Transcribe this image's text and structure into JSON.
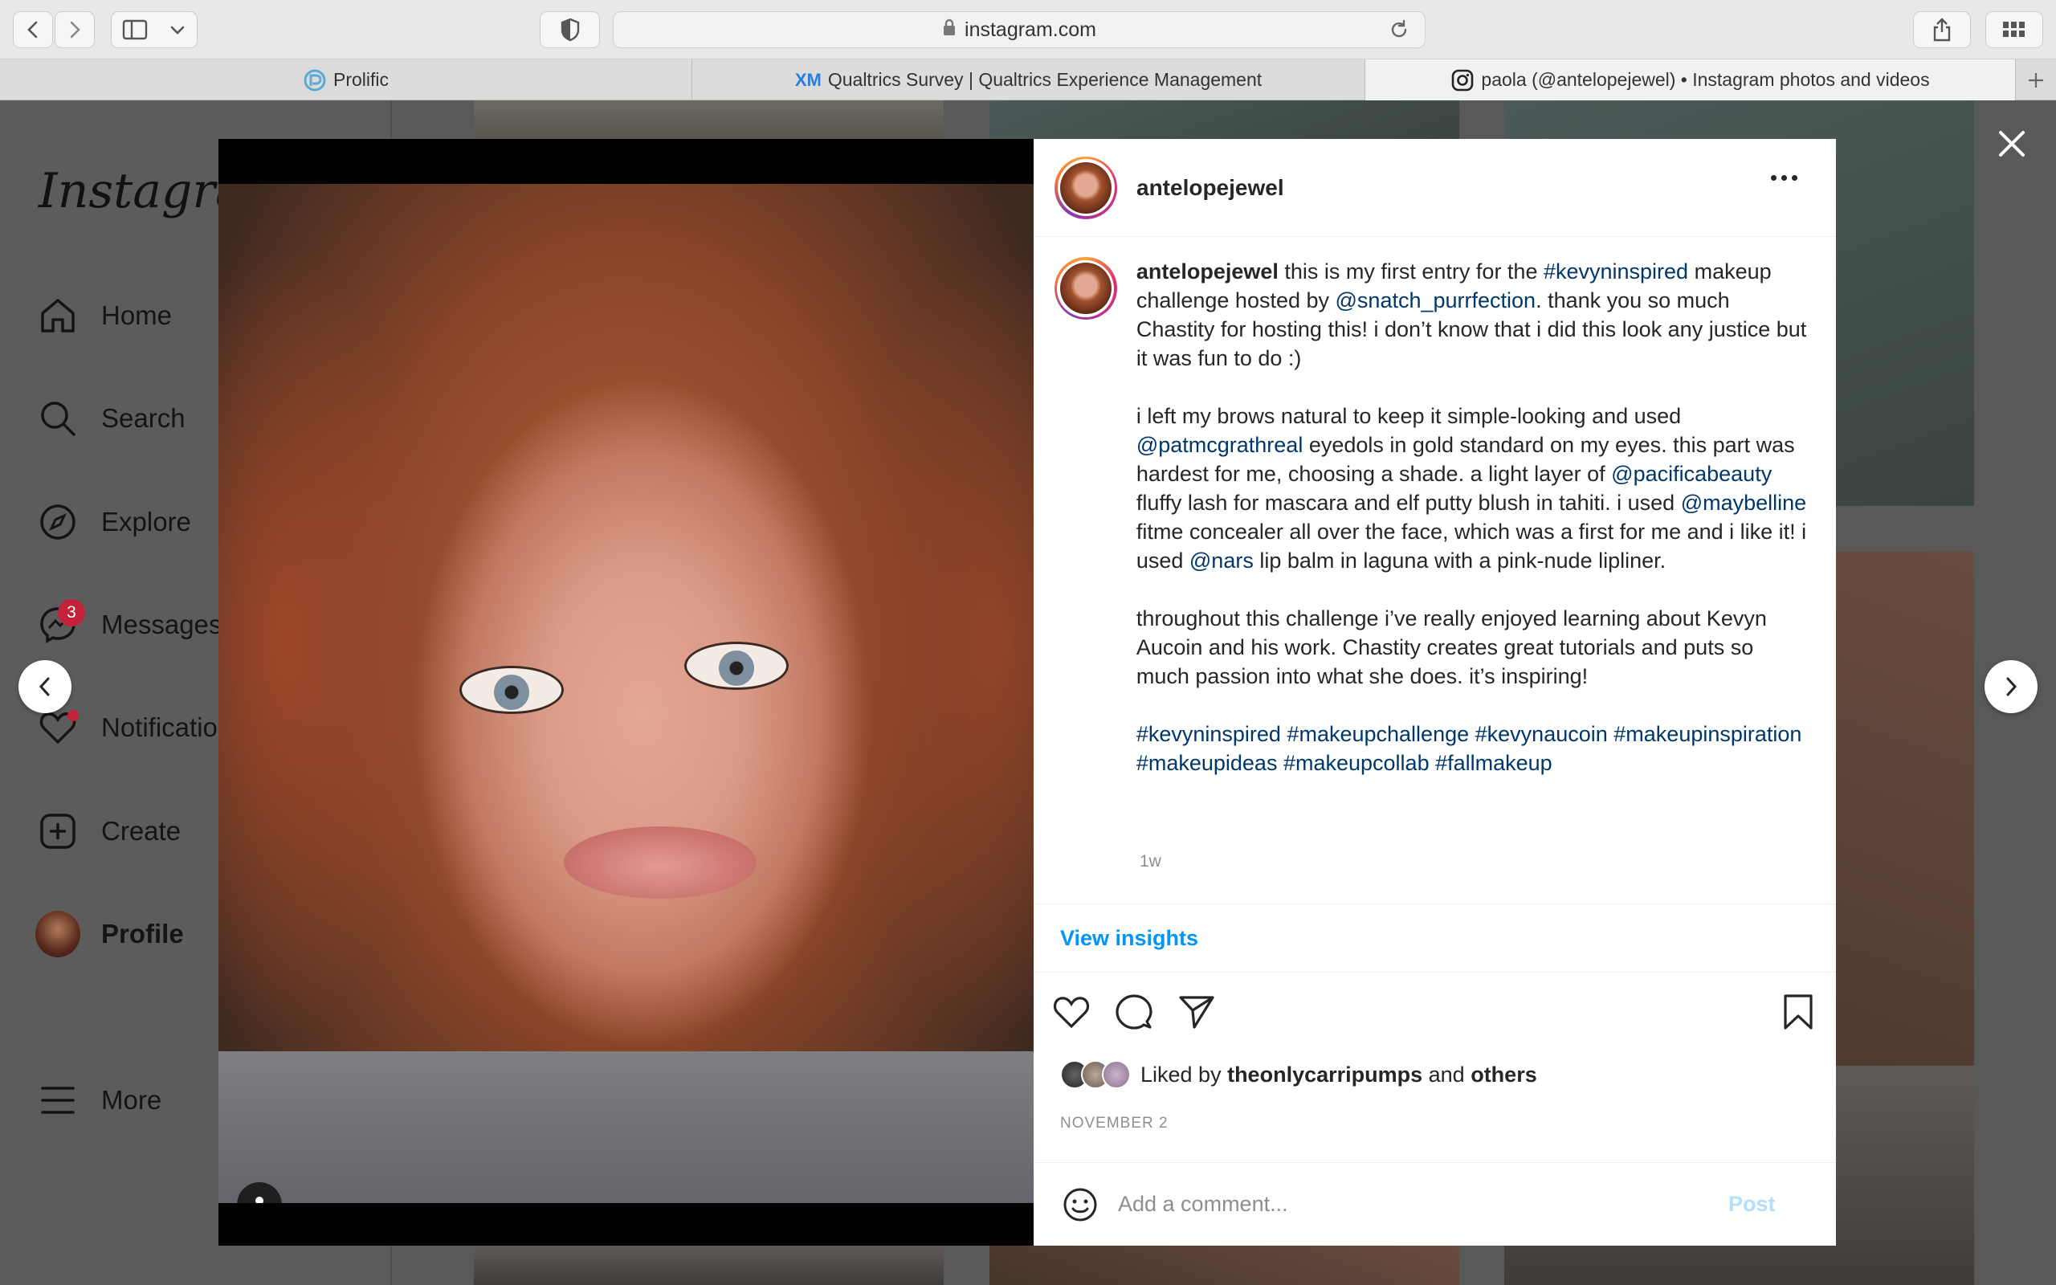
{
  "browser": {
    "address": "instagram.com",
    "tabs": [
      {
        "label": "Prolific",
        "icon": "prolific-icon"
      },
      {
        "label": "Qualtrics Survey | Qualtrics Experience Management",
        "icon": "qualtrics-xm-icon",
        "icon_text": "XM"
      },
      {
        "label": "paola (@antelopejewel) • Instagram photos and videos",
        "icon": "instagram-icon",
        "active": true
      }
    ]
  },
  "sidebar": {
    "logo": "Instagram",
    "items": [
      {
        "label": "Home",
        "icon": "home-icon"
      },
      {
        "label": "Search",
        "icon": "search-icon"
      },
      {
        "label": "Explore",
        "icon": "compass-icon"
      },
      {
        "label": "Messages",
        "icon": "messenger-icon",
        "badge": "3"
      },
      {
        "label": "Notifications",
        "icon": "heart-icon",
        "has_dot": true
      },
      {
        "label": "Create",
        "icon": "plus-square-icon"
      },
      {
        "label": "Profile",
        "icon": "avatar"
      },
      {
        "label": "More",
        "icon": "hamburger-icon"
      }
    ]
  },
  "post": {
    "username": "antelopejewel",
    "caption": {
      "p1": {
        "user": "antelopejewel",
        "t1": " this is my first entry for the ",
        "tag1": "#kevyninspired",
        "t2": " makeup challenge hosted by ",
        "mention1": "@snatch_purrfection",
        "t3": ". thank you so much Chastity for hosting this! i don’t know that i did this look any justice but it was fun to do :)"
      },
      "p2": {
        "t1": "i left my brows natural to keep it simple-looking and used ",
        "m1": "@patmcgrathreal",
        "t2": " eyedols in gold standard on my eyes. this part was hardest for me, choosing a shade. a light layer of ",
        "m2": "@pacificabeauty",
        "t3": " fluffy lash for mascara and elf putty blush in tahiti. i used ",
        "m3": "@maybelline",
        "t4": " fitme concealer all over the face, which was a first for me and i like it! i used ",
        "m4": "@nars",
        "t5": " lip balm in laguna with a pink-nude lipliner."
      },
      "p3": "throughout this challenge i’ve really enjoyed learning about Kevyn Aucoin and his work. Chastity creates great tutorials and puts so much passion into what she does. it’s inspiring!",
      "hashtags": [
        "#kevyninspired",
        "#makeupchallenge",
        "#kevynaucoin",
        "#makeupinspiration",
        "#makeupideas",
        "#makeupcollab",
        "#fallmakeup"
      ]
    },
    "time_ago": "1w",
    "view_insights": "View insights",
    "liked_by": {
      "prefix": "Liked by ",
      "user": "theonlycarripumps",
      "mid": " and ",
      "others": "others"
    },
    "date": "NOVEMBER 2",
    "comment_placeholder": "Add a comment...",
    "post_label": "Post"
  },
  "colors": {
    "link_blue": "#00376b",
    "insights_blue": "#0095f6",
    "post_disabled": "#b2dffc",
    "badge_red": "#c4213a"
  }
}
